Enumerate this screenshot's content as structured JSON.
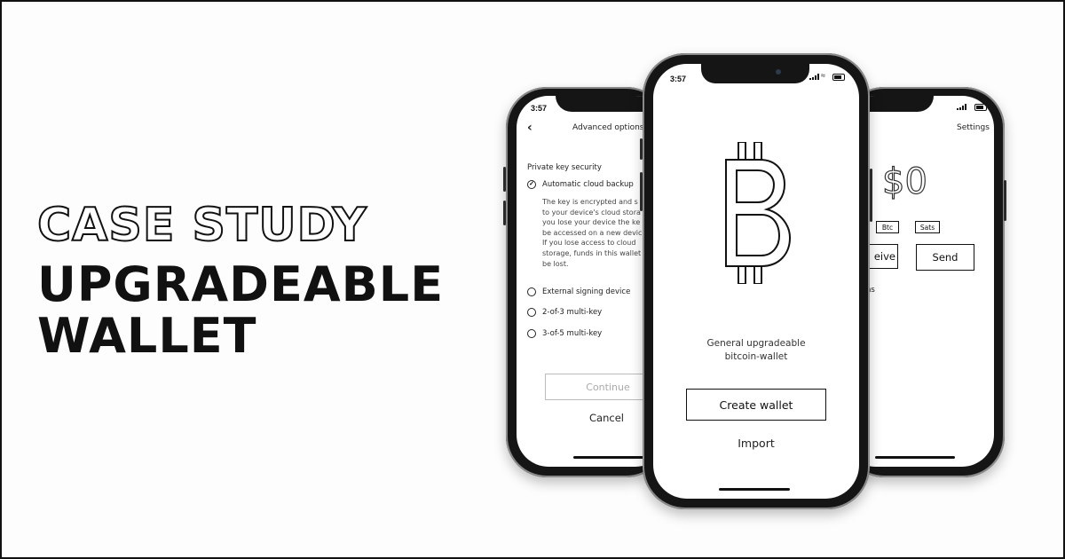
{
  "headline": {
    "outline_text": "CASE STUDY",
    "line1": "UPGRADEABLE",
    "line2": "WALLET"
  },
  "left_phone": {
    "time": "3:57",
    "title": "Advanced options",
    "section_label": "Private key security",
    "options": [
      {
        "label": "Automatic cloud backup",
        "selected": true
      },
      {
        "label": "External signing device",
        "selected": false
      },
      {
        "label": "2-of-3 multi-key",
        "selected": false
      },
      {
        "label": "3-of-5 multi-key",
        "selected": false
      }
    ],
    "description_lines": [
      "The key is encrypted and s",
      "to your device's cloud stora",
      "you lose your device the ke",
      "be accessed on a new devic",
      "If you lose access to cloud",
      "storage, funds in this wallet",
      "be lost."
    ],
    "continue_label": "Continue",
    "cancel_label": "Cancel"
  },
  "center_phone": {
    "time": "3:57",
    "logo_glyph": "B",
    "tagline_line1": "General upgradeable",
    "tagline_line2": "bitcoin-wallet",
    "create_label": "Create wallet",
    "import_label": "Import"
  },
  "right_phone": {
    "settings_label": "Settings",
    "balance": "$0",
    "unit_btc": "Btc",
    "unit_sats": "Sats",
    "receive_label": "eive",
    "send_label": "Send",
    "transactions_fragment": "ns"
  }
}
